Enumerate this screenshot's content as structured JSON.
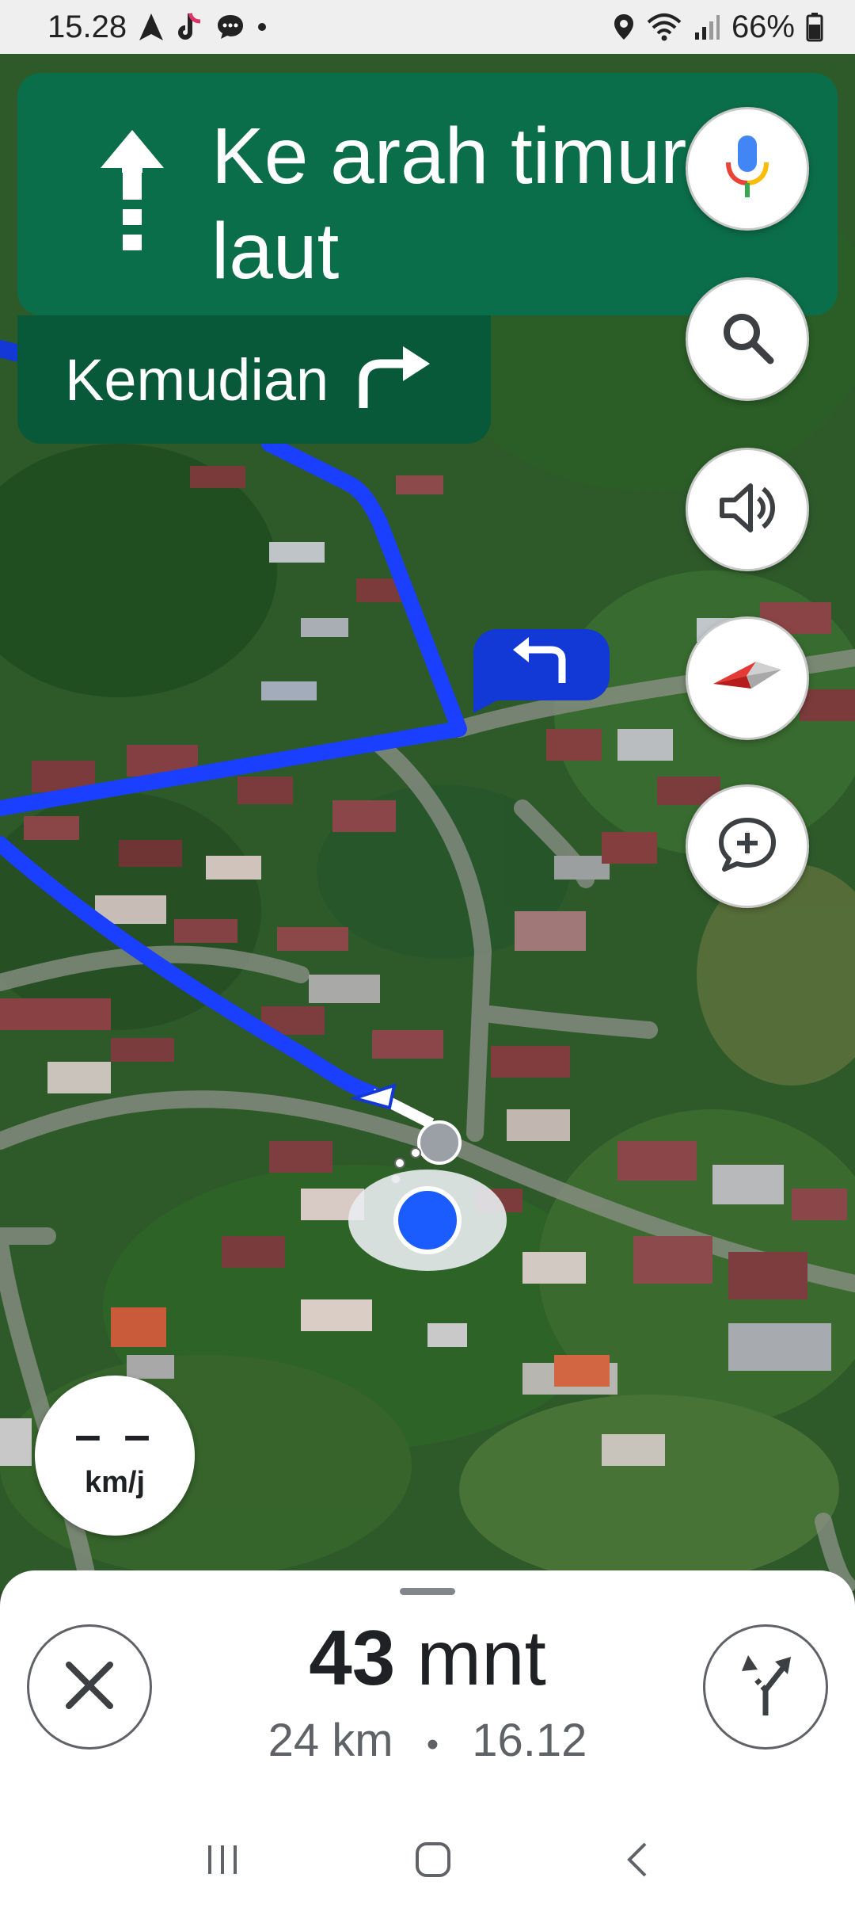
{
  "status_bar": {
    "time": "15.28",
    "battery": "66%"
  },
  "direction": {
    "instruction": "Ke arah timur laut",
    "then_label": "Kemudian"
  },
  "speed": {
    "value": "– –",
    "unit": "km/j"
  },
  "trip": {
    "duration_number": "43",
    "duration_unit": " mnt",
    "distance": "24 km",
    "separator": "•",
    "arrival_time": "16.12"
  },
  "colors": {
    "banner_green": "#0b6e4a",
    "banner_dark_green": "#07593a",
    "route_blue": "#1a3fff",
    "location_blue": "#1a5cff"
  },
  "icons": {
    "banner": "straight-arrow-icon",
    "then": "turn-right-icon",
    "voice": "microphone-icon",
    "search": "search-icon",
    "sound": "speaker-icon",
    "compass": "compass-icon",
    "report": "add-comment-icon",
    "close": "close-icon",
    "alt_routes": "alternate-routes-icon"
  }
}
